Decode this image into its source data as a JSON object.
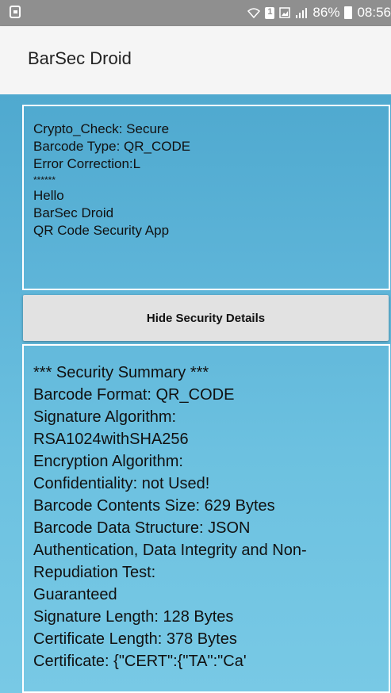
{
  "status_bar": {
    "battery": "86%",
    "time": "08:56",
    "icons": [
      "notification-icon",
      "wifi-icon",
      "sim-icon",
      "image-icon",
      "signal-icon",
      "battery-icon"
    ]
  },
  "app_bar": {
    "title": "BarSec Droid"
  },
  "decoded_panel": {
    "lines": [
      "Crypto_Check: Secure",
      "Barcode Type: QR_CODE",
      "Error Correction:L",
      "******",
      "Hello",
      "BarSec Droid",
      "QR Code Security App"
    ]
  },
  "toggle_button": {
    "label": "Hide Security Details"
  },
  "summary_panel": {
    "lines": [
      "*** Security Summary ***",
      "Barcode Format: QR_CODE",
      "Signature Algorithm:",
      "RSA1024withSHA256",
      "Encryption Algorithm:",
      "Confidentiality: not Used!",
      "Barcode Contents Size: 629 Bytes",
      "Barcode Data Structure: JSON",
      "Authentication, Data Integrity and Non-",
      "Repudiation Test:",
      "Guaranteed",
      "Signature Length: 128 Bytes",
      "Certificate Length: 378 Bytes",
      "Certificate: {\"CERT\":{\"TA\":\"Ca'"
    ]
  },
  "colors": {
    "status_bar": "#8f8f8f",
    "app_bar": "#f5f5f5",
    "background_top": "#4fa9cf",
    "background_bottom": "#78c9e5",
    "button": "#e2e2e2"
  }
}
